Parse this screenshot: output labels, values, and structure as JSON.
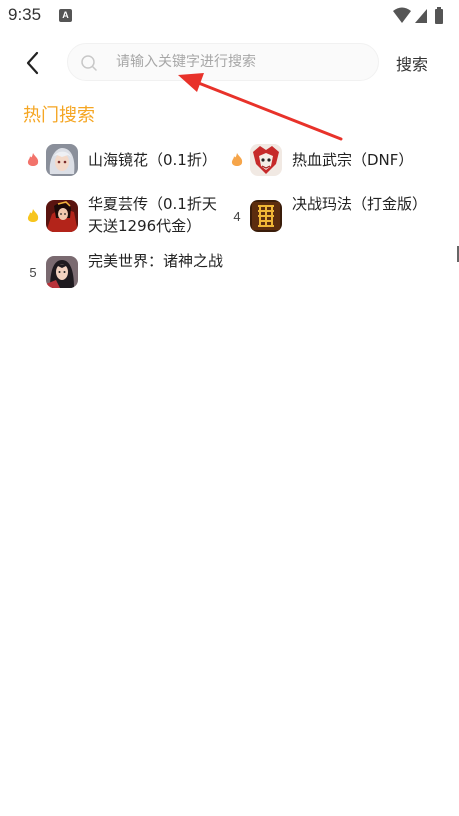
{
  "status_bar": {
    "time": "9:35",
    "app_icon_letter": "A"
  },
  "header": {
    "search_placeholder": "请输入关键字进行搜索",
    "search_button": "搜索"
  },
  "hot_search": {
    "title": "热门搜索",
    "items": [
      {
        "rank": "1",
        "rank_icon": "flame-red-icon",
        "name": "山海镜花（0.1折）",
        "game_icon": "silver-hair-character-icon"
      },
      {
        "rank": "2",
        "rank_icon": "flame-orange-icon",
        "name": "热血武宗（DNF）",
        "game_icon": "red-mask-warrior-icon"
      },
      {
        "rank": "3",
        "rank_icon": "flame-yellow-icon",
        "name": "华夏芸传（0.1折天天送1296代金）",
        "game_icon": "red-robe-heroine-icon"
      },
      {
        "rank": "4",
        "name": "决战玛法（打金版）",
        "game_icon": "golden-dragon-glyph-icon"
      },
      {
        "rank": "5",
        "name": "完美世界：诸神之战",
        "game_icon": "dark-hair-heroine-icon"
      }
    ]
  },
  "colors": {
    "accent": "#f5a623",
    "annotation_arrow": "#e8322a",
    "flame_1": "#f2736b",
    "flame_2": "#f6a54a",
    "flame_3": "#f7c51e"
  }
}
